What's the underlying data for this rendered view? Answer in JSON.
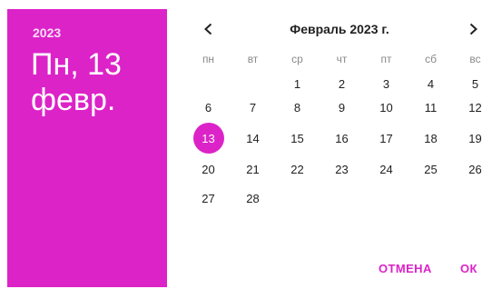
{
  "header": {
    "year": "2023",
    "date": "Пн, 13 февр."
  },
  "calendar": {
    "month_label": "Февраль 2023 г.",
    "weekdays": [
      "пн",
      "вт",
      "ср",
      "чт",
      "пт",
      "сб",
      "вс"
    ],
    "weeks": [
      [
        "",
        "",
        "1",
        "2",
        "3",
        "4",
        "5"
      ],
      [
        "6",
        "7",
        "8",
        "9",
        "10",
        "11",
        "12"
      ],
      [
        "13",
        "14",
        "15",
        "16",
        "17",
        "18",
        "19"
      ],
      [
        "20",
        "21",
        "22",
        "23",
        "24",
        "25",
        "26"
      ],
      [
        "27",
        "28",
        "",
        "",
        "",
        "",
        ""
      ]
    ],
    "selected_day": "13"
  },
  "actions": {
    "cancel_label": "ОТМЕНА",
    "ok_label": "ОК"
  },
  "colors": {
    "accent": "#dc23c8",
    "text": "#212121",
    "weekday_text": "#8a8a8a"
  },
  "icons": {
    "prev": "chevron-left-icon",
    "next": "chevron-right-icon"
  }
}
